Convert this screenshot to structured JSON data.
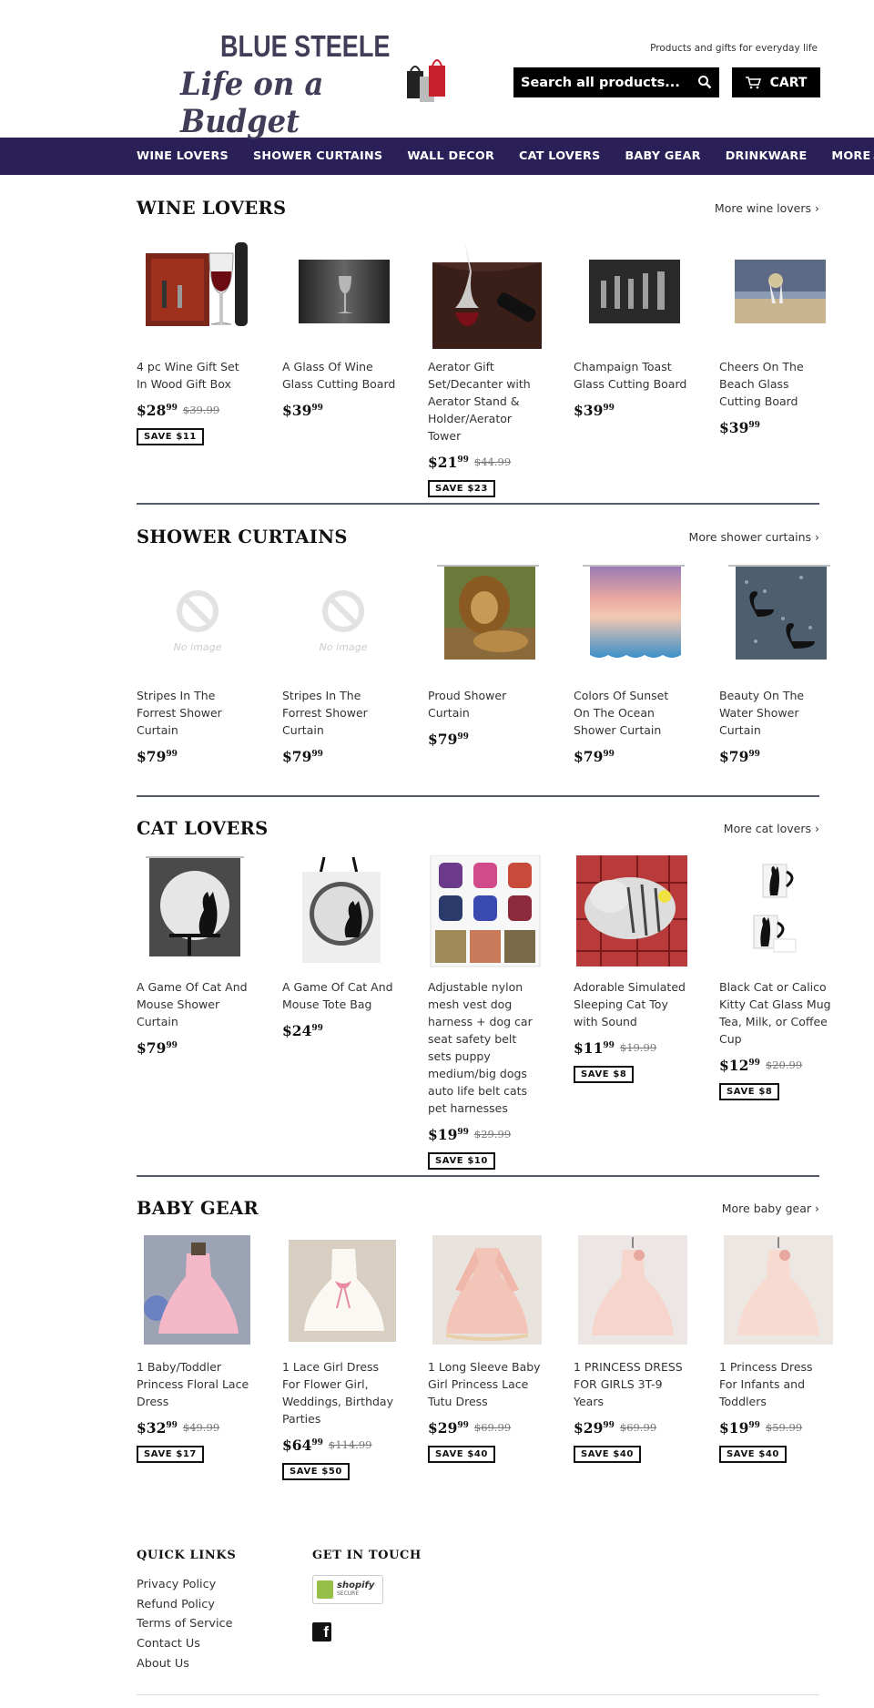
{
  "store": {
    "logo_top": "BLUE STEELE",
    "logo_bottom": "Life on a Budget",
    "tagline": "Products and gifts for everyday life",
    "search_placeholder": "Search all products...",
    "cart_label": "CART"
  },
  "nav": [
    {
      "label": "WINE LOVERS"
    },
    {
      "label": "SHOWER CURTAINS"
    },
    {
      "label": "WALL DECOR"
    },
    {
      "label": "CAT LOVERS"
    },
    {
      "label": "BABY GEAR"
    },
    {
      "label": "DRINKWARE"
    },
    {
      "label": "MORE"
    }
  ],
  "collections": [
    {
      "title": "WINE LOVERS",
      "more": "More wine lovers ›",
      "products": [
        {
          "title": "4 pc Wine Gift Set In Wood Gift Box",
          "price": "$28",
          "cents": "99",
          "regular": "$39.99",
          "save": "SAVE $11",
          "image": "wine-gift-box"
        },
        {
          "title": "A Glass Of Wine Glass Cutting Board",
          "price": "$39",
          "cents": "99",
          "regular": "",
          "save": "",
          "image": "wine-glass-board"
        },
        {
          "title": "Aerator Gift Set/Decanter with Aerator Stand & Holder/Aerator Tower",
          "price": "$21",
          "cents": "99",
          "regular": "$44.99",
          "save": "SAVE $23",
          "image": "aerator-tower"
        },
        {
          "title": "Champaign Toast Glass Cutting Board",
          "price": "$39",
          "cents": "99",
          "regular": "",
          "save": "",
          "image": "champagne-board"
        },
        {
          "title": "Cheers On The Beach Glass Cutting Board",
          "price": "$39",
          "cents": "99",
          "regular": "",
          "save": "",
          "image": "beach-board"
        }
      ]
    },
    {
      "title": "SHOWER CURTAINS",
      "more": "More shower curtains ›",
      "products": [
        {
          "title": "Stripes In The Forrest Shower Curtain",
          "price": "$79",
          "cents": "99",
          "regular": "",
          "save": "",
          "image": "no-image"
        },
        {
          "title": "Stripes In The Forrest Shower Curtain",
          "price": "$79",
          "cents": "99",
          "regular": "",
          "save": "",
          "image": "no-image"
        },
        {
          "title": "Proud Shower Curtain",
          "price": "$79",
          "cents": "99",
          "regular": "",
          "save": "",
          "image": "lion-curtain"
        },
        {
          "title": "Colors Of Sunset On The Ocean Shower Curtain",
          "price": "$79",
          "cents": "99",
          "regular": "",
          "save": "",
          "image": "sunset-curtain"
        },
        {
          "title": "Beauty On The Water Shower Curtain",
          "price": "$79",
          "cents": "99",
          "regular": "",
          "save": "",
          "image": "swan-curtain"
        }
      ]
    },
    {
      "title": "CAT LOVERS",
      "more": "More cat lovers ›",
      "products": [
        {
          "title": "A Game Of Cat And Mouse Shower Curtain",
          "price": "$79",
          "cents": "99",
          "regular": "",
          "save": "",
          "image": "cat-moon-curtain"
        },
        {
          "title": "A Game Of Cat And Mouse Tote Bag",
          "price": "$24",
          "cents": "99",
          "regular": "",
          "save": "",
          "image": "cat-moon-tote"
        },
        {
          "title": "Adjustable nylon mesh vest dog harness + dog car seat safety belt sets puppy medium/big dogs auto life belt cats pet harnesses",
          "price": "$19",
          "cents": "99",
          "regular": "$29.99",
          "save": "SAVE $10",
          "image": "harness-grid"
        },
        {
          "title": "Adorable Simulated Sleeping Cat Toy with Sound",
          "price": "$11",
          "cents": "99",
          "regular": "$19.99",
          "save": "SAVE $8",
          "image": "sleeping-cat"
        },
        {
          "title": "Black Cat or Calico Kitty Cat Glass Mug Tea, Milk, or Coffee Cup",
          "price": "$12",
          "cents": "99",
          "regular": "$20.99",
          "save": "SAVE $8",
          "image": "cat-mugs"
        }
      ]
    },
    {
      "title": "BABY GEAR",
      "more": "More baby gear ›",
      "products": [
        {
          "title": "1 Baby/Toddler Princess Floral Lace Dress",
          "price": "$32",
          "cents": "99",
          "regular": "$49.99",
          "save": "SAVE $17",
          "image": "pink-dress-blue-bg"
        },
        {
          "title": "1 Lace Girl Dress For Flower Girl, Weddings, Birthday Parties",
          "price": "$64",
          "cents": "99",
          "regular": "$114.99",
          "save": "SAVE $50",
          "image": "white-dress"
        },
        {
          "title": "1 Long Sleeve Baby Girl Princess Lace Tutu Dress",
          "price": "$29",
          "cents": "99",
          "regular": "$69.99",
          "save": "SAVE $40",
          "image": "long-sleeve-dress"
        },
        {
          "title": "1 PRINCESS DRESS FOR GIRLS 3T-9 Years",
          "price": "$29",
          "cents": "99",
          "regular": "$69.99",
          "save": "SAVE $40",
          "image": "princess-dress"
        },
        {
          "title": "1 Princess Dress For Infants and Toddlers",
          "price": "$19",
          "cents": "99",
          "regular": "$59.99",
          "save": "SAVE $40",
          "image": "infant-dress"
        }
      ]
    }
  ],
  "footer": {
    "quick_links_title": "QUICK LINKS",
    "quick_links": [
      "Privacy Policy",
      "Refund Policy",
      "Terms of Service",
      "Contact Us",
      "About Us"
    ],
    "get_in_touch_title": "GET IN TOUCH",
    "shopify_badge": "shopify",
    "shopify_secure": "SECURE"
  },
  "colors": {
    "nav_bg": "#2a2057",
    "logo": "#3f3d57",
    "button_bg": "#000000"
  }
}
